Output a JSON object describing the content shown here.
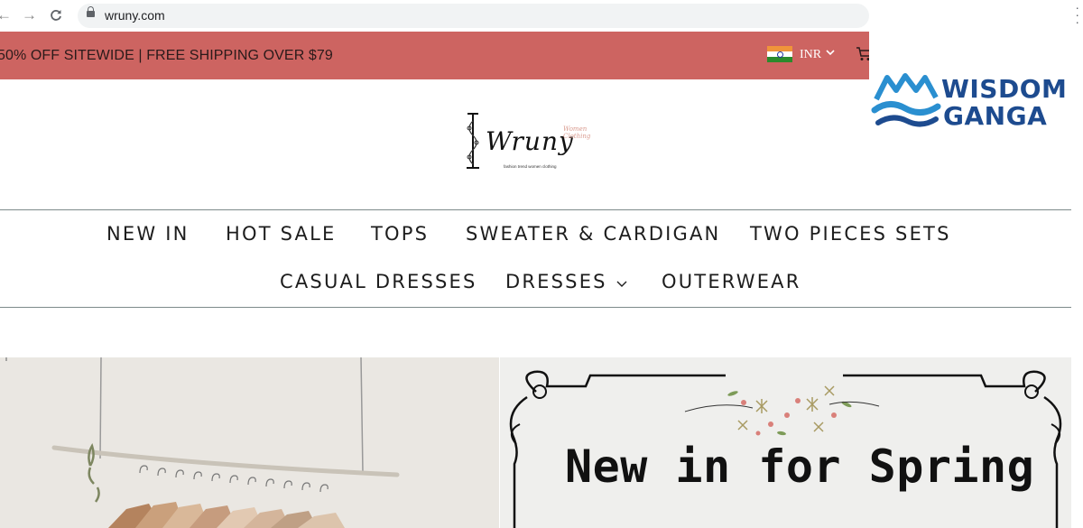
{
  "browser": {
    "url": "wruny.com",
    "back_icon": "back-arrow-icon",
    "forward_icon": "forward-arrow-icon",
    "reload_icon": "reload-icon"
  },
  "announcement": {
    "text": "50% OFF SITEWIDE | FREE SHIPPING OVER $79",
    "currency": "INR",
    "background": "#cd6461"
  },
  "watermark": {
    "line1": "WISDOM",
    "line2": "GANGA",
    "color": "#1d4b8f"
  },
  "logo": {
    "name": "Wruny",
    "tagline": "Women Clothing",
    "subtext": "fashion trend women clothing"
  },
  "menu": {
    "row1": [
      "NEW IN",
      "HOT SALE",
      "TOPS",
      "SWEATER & CARDIGAN",
      "TWO PIECES SETS"
    ],
    "row2": [
      "CASUAL DRESSES",
      "DRESSES",
      "OUTERWEAR"
    ]
  },
  "banners": {
    "right_headline": "New in for Spring"
  }
}
